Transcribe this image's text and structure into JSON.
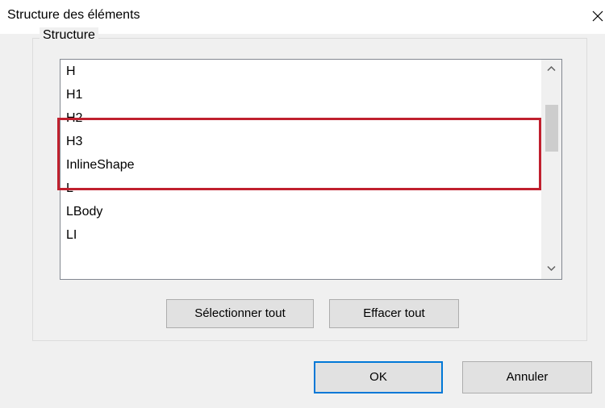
{
  "window": {
    "title": "Structure des éléments",
    "close_icon": "close-icon"
  },
  "group": {
    "legend": "Structure"
  },
  "list": {
    "items": [
      {
        "label": "H"
      },
      {
        "label": "H1"
      },
      {
        "label": "H2"
      },
      {
        "label": "H3"
      },
      {
        "label": "InlineShape"
      },
      {
        "label": "L"
      },
      {
        "label": "LBody"
      },
      {
        "label": "LI"
      }
    ],
    "highlight_color": "#c0202e",
    "scroll_up_icon": "chevron-up-icon",
    "scroll_down_icon": "chevron-down-icon"
  },
  "buttons": {
    "select_all": "Sélectionner tout",
    "clear_all": "Effacer tout",
    "ok": "OK",
    "cancel": "Annuler"
  },
  "colors": {
    "dialog_background": "#f0f0f0",
    "default_button_border": "#0078d7"
  }
}
